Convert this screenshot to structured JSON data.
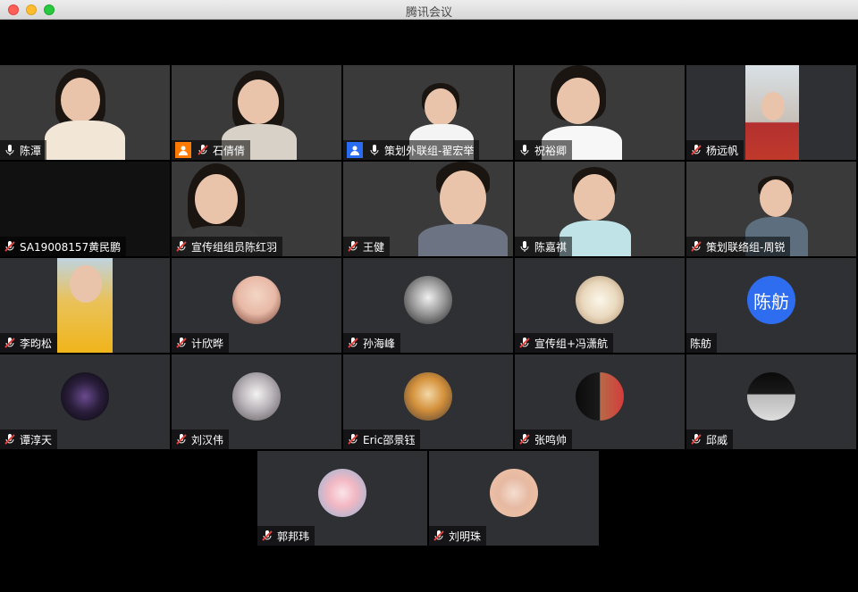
{
  "window": {
    "title": "腾讯会议"
  },
  "participants": [
    {
      "name": "陈潭",
      "mic": "on",
      "badge": ""
    },
    {
      "name": "石倩倩",
      "mic": "muted",
      "badge": "host"
    },
    {
      "name": "策划外联组-翟宏举",
      "mic": "on",
      "badge": "cohost"
    },
    {
      "name": "祝裕卿",
      "mic": "on",
      "badge": ""
    },
    {
      "name": "杨远帆",
      "mic": "muted",
      "badge": ""
    },
    {
      "name": "SA19008157黄民鹏",
      "mic": "muted",
      "badge": ""
    },
    {
      "name": "宣传组组员陈红羽",
      "mic": "muted",
      "badge": ""
    },
    {
      "name": "王健",
      "mic": "muted",
      "badge": ""
    },
    {
      "name": "陈嘉祺",
      "mic": "on",
      "badge": ""
    },
    {
      "name": "策划联络组-周锐",
      "mic": "muted",
      "badge": ""
    },
    {
      "name": "李昀松",
      "mic": "muted",
      "badge": ""
    },
    {
      "name": "计欣晔",
      "mic": "muted",
      "badge": ""
    },
    {
      "name": "孙海峰",
      "mic": "muted",
      "badge": ""
    },
    {
      "name": "宣传组+冯潇航",
      "mic": "muted",
      "badge": ""
    },
    {
      "name": "陈舫",
      "mic": "none",
      "badge": "",
      "avatar_text": "陈舫"
    },
    {
      "name": "谭淳天",
      "mic": "muted",
      "badge": ""
    },
    {
      "name": "刘汉伟",
      "mic": "muted",
      "badge": ""
    },
    {
      "name": "Eric邵景钰",
      "mic": "muted",
      "badge": ""
    },
    {
      "name": "张鸣帅",
      "mic": "muted",
      "badge": ""
    },
    {
      "name": "邱威",
      "mic": "muted",
      "badge": ""
    },
    {
      "name": "郭邦玮",
      "mic": "muted",
      "badge": ""
    },
    {
      "name": "刘明珠",
      "mic": "muted",
      "badge": ""
    }
  ],
  "colors": {
    "tile": "#2f3033",
    "muted_mic": "#e0413a",
    "host_badge": "#ff7a00",
    "cohost_badge": "#2a6cf0",
    "avatar_blue": "#2f6df0"
  }
}
